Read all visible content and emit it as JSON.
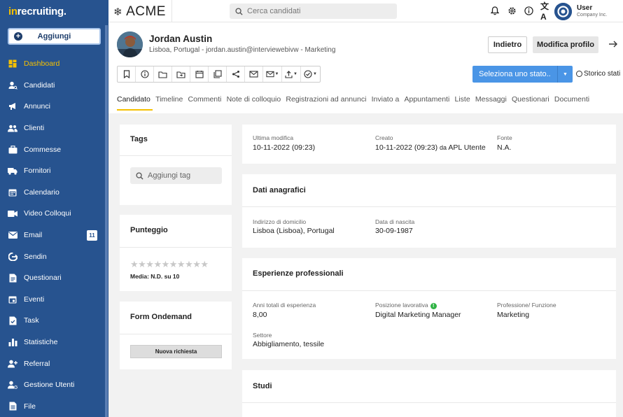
{
  "brand": {
    "prefix": "in",
    "name": "recruiting."
  },
  "sidebar": {
    "add_label": "Aggiungi",
    "items": [
      {
        "label": "Dashboard",
        "icon": "dashboard-icon",
        "active": true
      },
      {
        "label": "Candidati",
        "icon": "user-search-icon"
      },
      {
        "label": "Annunci",
        "icon": "megaphone-icon"
      },
      {
        "label": "Clienti",
        "icon": "users-icon"
      },
      {
        "label": "Commesse",
        "icon": "briefcase-icon"
      },
      {
        "label": "Fornitori",
        "icon": "truck-icon"
      },
      {
        "label": "Calendario",
        "icon": "calendar-icon"
      },
      {
        "label": "Video Colloqui",
        "icon": "video-icon"
      },
      {
        "label": "Email",
        "icon": "mail-icon",
        "count": "11"
      },
      {
        "label": "Sendin",
        "icon": "send-icon"
      },
      {
        "label": "Questionari",
        "icon": "form-icon"
      },
      {
        "label": "Eventi",
        "icon": "event-icon"
      },
      {
        "label": "Task",
        "icon": "task-icon"
      },
      {
        "label": "Statistiche",
        "icon": "chart-icon"
      },
      {
        "label": "Referral",
        "icon": "referral-icon"
      },
      {
        "label": "Gestione Utenti",
        "icon": "user-gear-icon"
      },
      {
        "label": "File",
        "icon": "file-icon"
      }
    ]
  },
  "topbar": {
    "logo_text": "ACME",
    "search_placeholder": "Cerca candidati",
    "user_name": "User",
    "user_company": "Company Inc."
  },
  "candidate": {
    "name": "Jordan Austin",
    "subtitle": "Lisboa, Portugal - jordan.austin@interviewebivw - Marketing"
  },
  "actions": {
    "back_label": "Indietro",
    "edit_label": "Modifica profilo",
    "state_select": "Seleziona uno stato..",
    "history_label": "Storico stati"
  },
  "tabs": [
    "Candidato",
    "Timeline",
    "Commenti",
    "Note di colloquio",
    "Registrazioni ad annunci",
    "Inviato a",
    "Appuntamenti",
    "Liste",
    "Messaggi",
    "Questionari",
    "Documenti"
  ],
  "tags_card": {
    "title": "Tags",
    "placeholder": "Aggiungi tag"
  },
  "score_card": {
    "title": "Punteggio",
    "stars": "★★★★★★★★★★",
    "media": "Media: N.D. su 10"
  },
  "form_card": {
    "title": "Form Ondemand",
    "button": "Nuova richiesta"
  },
  "meta": {
    "modified_label": "Ultima modifica",
    "modified_value": "10-11-2022 (09:23)",
    "created_label": "Creato",
    "created_value": "10-11-2022 (09:23)",
    "created_by_prefix": "da",
    "created_by": "APL Utente",
    "source_label": "Fonte",
    "source_value": "N.A."
  },
  "personal": {
    "title": "Dati anagrafici",
    "address_label": "Indirizzo di domicilio",
    "address_value": "Lisboa (Lisboa), Portugal",
    "birth_label": "Data di nascita",
    "birth_value": "30-09-1987"
  },
  "experience": {
    "title": "Esperienze professionali",
    "years_label": "Anni totali di esperienza",
    "years_value": "8,00",
    "position_label": "Posizione lavorativa",
    "position_badge": "!",
    "position_value": "Digital Marketing Manager",
    "profession_label": "Professione/ Funzione",
    "profession_value": "Marketing",
    "sector_label": "Settore",
    "sector_value": "Abbigliamento, tessile"
  },
  "studies": {
    "title": "Studi"
  }
}
